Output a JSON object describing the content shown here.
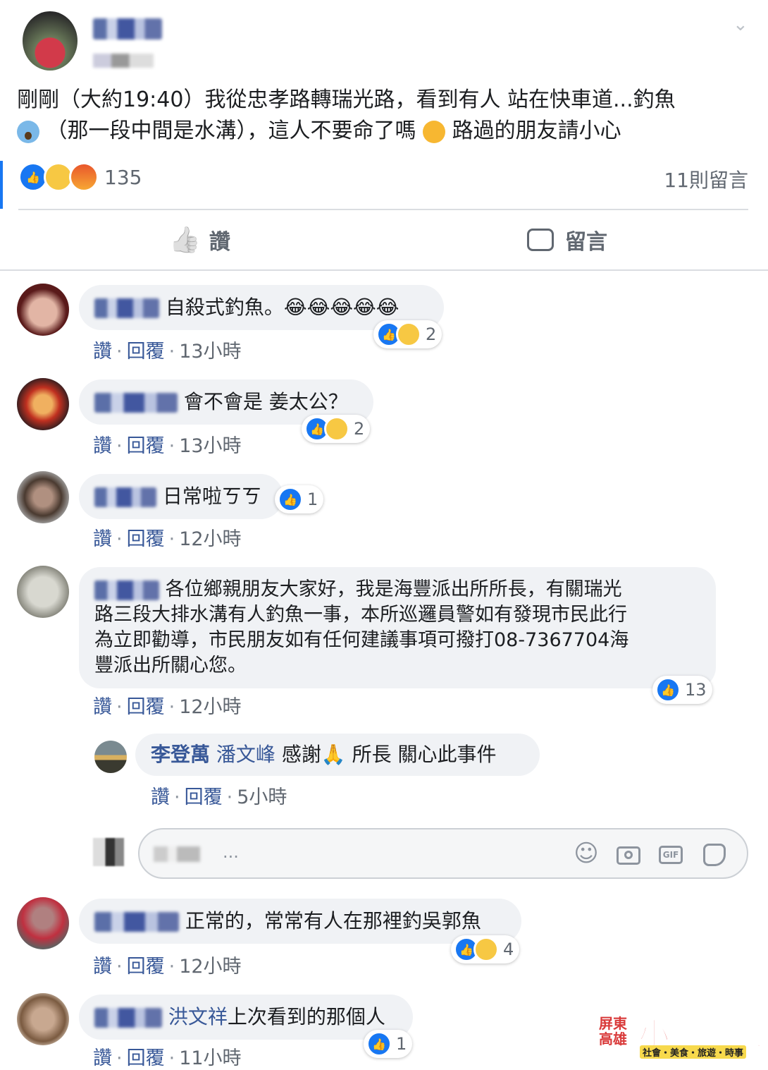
{
  "post": {
    "text_line1": "剛剛（大約19:40）我從忠孝路轉瑞光路，看到有人 站在快車道...釣魚",
    "text_line2_a": "（那一段中間是水溝），這人不要命了嗎",
    "text_line2_b": "路過的朋友請小心",
    "reaction_count": "135",
    "comment_count": "11則留言"
  },
  "actions": {
    "like_label": "讚",
    "comment_label": "留言"
  },
  "comments": [
    {
      "text": "自殺式釣魚。😂😂😂😂😂",
      "like": "讚",
      "reply": "回覆",
      "time": "13小時",
      "count": "2"
    },
    {
      "text": "會不會是 姜太公？",
      "like": "讚",
      "reply": "回覆",
      "time": "13小時",
      "count": "2"
    },
    {
      "text": "日常啦ㄎㄎ",
      "like": "讚",
      "reply": "回覆",
      "time": "12小時",
      "count": "1"
    },
    {
      "text_l1": "各位鄉親朋友大家好，我是海豐派出所所長，有關瑞光",
      "text_l2": "路三段大排水溝有人釣魚一事，本所巡邏員警如有發現市民此行",
      "text_l3": "為立即勸導，市民朋友如有任何建議事項可撥打08-7367704海",
      "text_l4": "豐派出所關心您。",
      "like": "讚",
      "reply": "回覆",
      "time": "12小時",
      "count": "13"
    },
    {
      "name": "李登萬",
      "tag": "潘文峰",
      "text_a": "感謝",
      "text_b": "所長 關心此事件",
      "like": "讚",
      "reply": "回覆",
      "time": "5小時"
    },
    {
      "text": "正常的，常常有人在那裡釣吳郭魚",
      "like": "讚",
      "reply": "回覆",
      "time": "12小時",
      "count": "4"
    },
    {
      "tag": "洪文祥",
      "text": "上次看到的那個人",
      "like": "讚",
      "reply": "回覆",
      "time": "11小時",
      "count": "1"
    }
  ],
  "reply_input": {
    "placeholder": "..."
  },
  "watermark": {
    "left": "屏東高雄",
    "main": "小鎮資訊",
    "sub": "社會・美食・旅遊・時事"
  }
}
